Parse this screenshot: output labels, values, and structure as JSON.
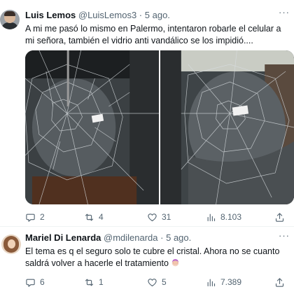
{
  "tweets": [
    {
      "author_name": "Luis Lemos",
      "author_handle": "@LuisLemos3",
      "separator": "·",
      "date": "5 ago.",
      "more": "···",
      "text": "A mi me pasó lo mismo en Palermo, intentaron robarle el celular a mi señora, también el vidrio anti vandálico se los impidió....",
      "stats": {
        "replies": "2",
        "retweets": "4",
        "likes": "31",
        "views": "8.103"
      },
      "avatar_icon": "user-avatar",
      "photos": [
        "shattered-car-window-photo",
        "shattered-car-window-photo"
      ]
    },
    {
      "author_name": "Mariel Di Lenarda",
      "author_handle": "@mdilenarda",
      "separator": "·",
      "date": "5 ago.",
      "more": "···",
      "text": "El tema es q el seguro solo te cubre el cristal. Ahora no se cuanto saldrá volver a hacerle el tratamiento",
      "text_emoji": "woman-facepalming-emoji",
      "stats": {
        "replies": "6",
        "retweets": "1",
        "likes": "5",
        "views": "7.389"
      },
      "avatar_icon": "user-avatar"
    }
  ],
  "icons": {
    "reply": "reply-icon",
    "retweet": "retweet-icon",
    "like": "heart-icon",
    "views": "views-chart-icon",
    "share": "share-icon"
  },
  "colors": {
    "text": "#0f1419",
    "secondary": "#536471",
    "divider": "#eff3f4"
  }
}
